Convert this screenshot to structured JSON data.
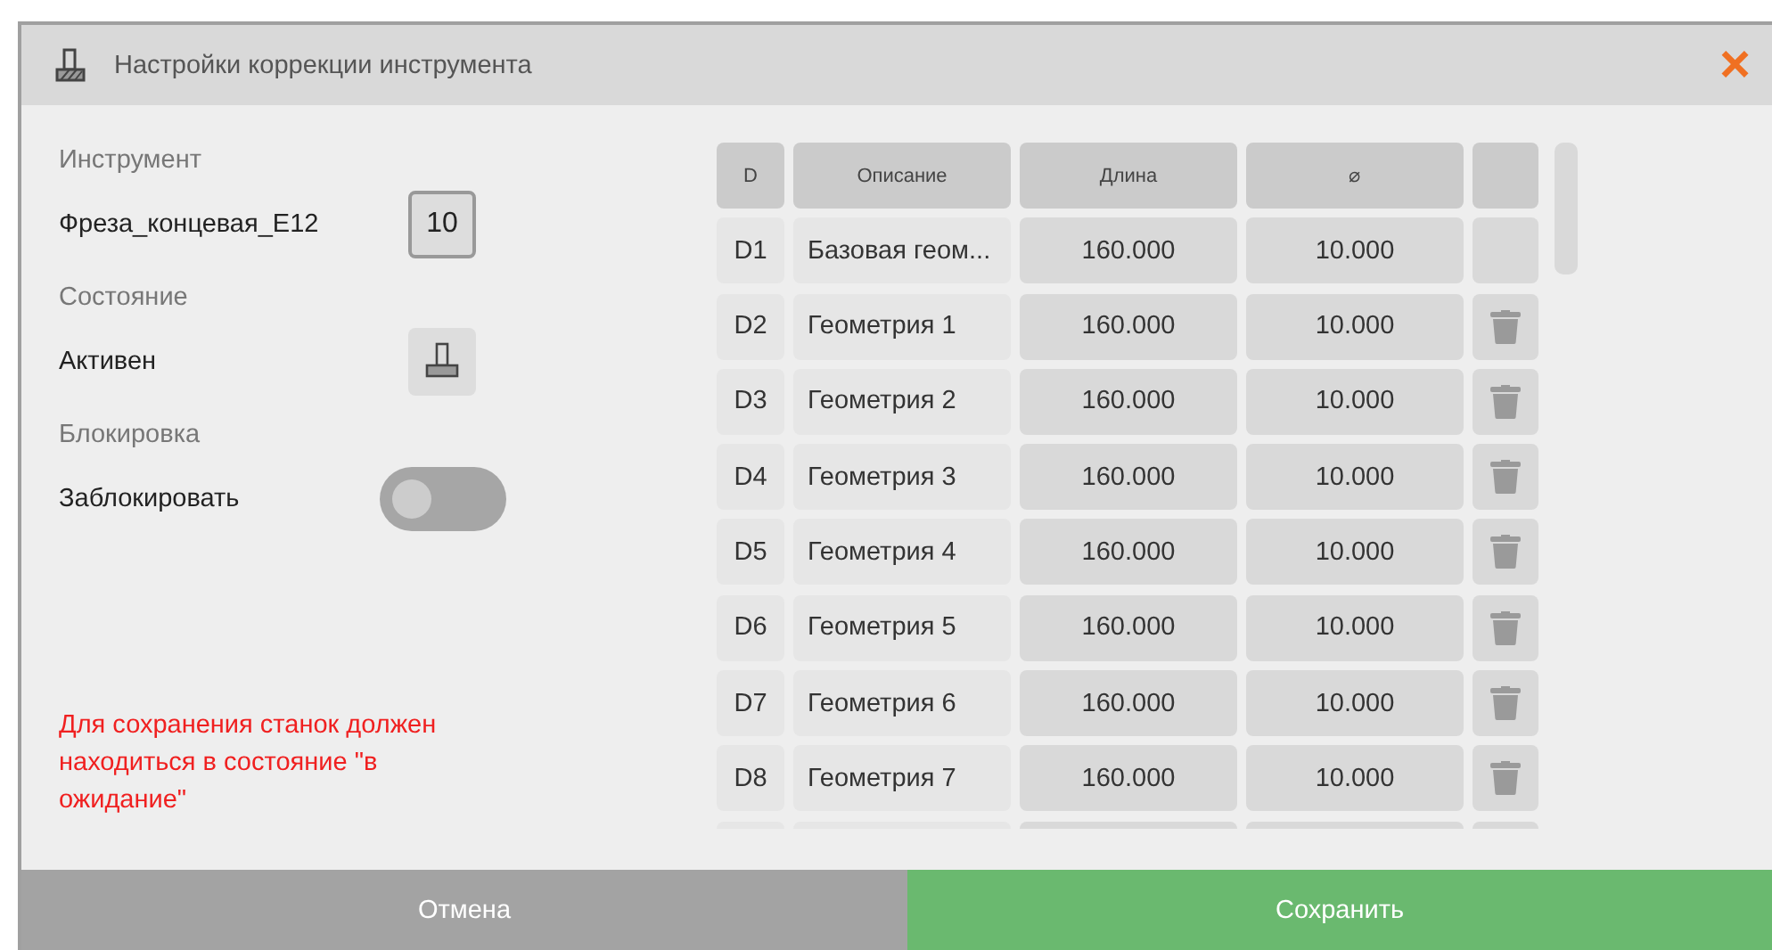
{
  "window": {
    "title": "Настройки коррекции инструмента",
    "close": "×"
  },
  "tool": {
    "label": "Инструмент",
    "name": "Фреза_концевая_E12",
    "number": "10"
  },
  "state": {
    "label": "Состояние",
    "value": "Активен"
  },
  "lock": {
    "label": "Блокировка",
    "text": "Заблокировать",
    "on": false
  },
  "warning": "Для сохранения станок должен находиться в состояние \"в ожидание\"",
  "table": {
    "columns": [
      "D",
      "Описание",
      "Длина",
      "⌀"
    ],
    "rows": [
      {
        "d": "D1",
        "description": "Базовая геом...",
        "length": "160.000",
        "diameter": "10.000",
        "deletable": false
      },
      {
        "d": "D2",
        "description": "Геометрия 1",
        "length": "160.000",
        "diameter": "10.000",
        "deletable": true
      },
      {
        "d": "D3",
        "description": "Геометрия 2",
        "length": "160.000",
        "diameter": "10.000",
        "deletable": true
      },
      {
        "d": "D4",
        "description": "Геометрия 3",
        "length": "160.000",
        "diameter": "10.000",
        "deletable": true
      },
      {
        "d": "D5",
        "description": "Геометрия 4",
        "length": "160.000",
        "diameter": "10.000",
        "deletable": true
      },
      {
        "d": "D6",
        "description": "Геометрия 5",
        "length": "160.000",
        "diameter": "10.000",
        "deletable": true
      },
      {
        "d": "D7",
        "description": "Геометрия 6",
        "length": "160.000",
        "diameter": "10.000",
        "deletable": true
      },
      {
        "d": "D8",
        "description": "Геометрия 7",
        "length": "160.000",
        "diameter": "10.000",
        "deletable": true
      }
    ]
  },
  "buttons": {
    "cancel": "Отмена",
    "save": "Сохранить"
  }
}
